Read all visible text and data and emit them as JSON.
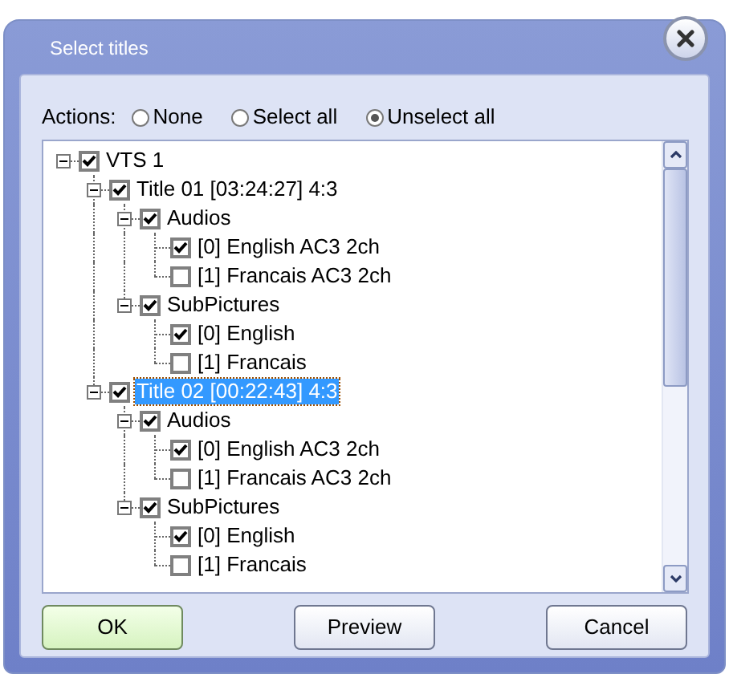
{
  "window": {
    "title": "Select titles"
  },
  "actions": {
    "label": "Actions:",
    "options": [
      {
        "label": "None",
        "selected": false
      },
      {
        "label": "Select all",
        "selected": false
      },
      {
        "label": "Unselect all",
        "selected": true
      }
    ]
  },
  "tree": [
    {
      "label": "VTS 1",
      "checked": true,
      "expanded": true,
      "selected": false,
      "children": [
        {
          "label": "Title 01 [03:24:27] 4:3",
          "checked": true,
          "expanded": true,
          "selected": false,
          "children": [
            {
              "label": "Audios",
              "checked": true,
              "expanded": true,
              "selected": false,
              "children": [
                {
                  "label": "[0] English AC3 2ch",
                  "checked": true,
                  "selected": false
                },
                {
                  "label": "[1] Francais AC3 2ch",
                  "checked": false,
                  "selected": false
                }
              ]
            },
            {
              "label": "SubPictures",
              "checked": true,
              "expanded": true,
              "selected": false,
              "children": [
                {
                  "label": "[0] English",
                  "checked": true,
                  "selected": false
                },
                {
                  "label": "[1] Francais",
                  "checked": false,
                  "selected": false
                }
              ]
            }
          ]
        },
        {
          "label": "Title 02 [00:22:43] 4:3",
          "checked": true,
          "expanded": true,
          "selected": true,
          "children": [
            {
              "label": "Audios",
              "checked": true,
              "expanded": true,
              "selected": false,
              "children": [
                {
                  "label": "[0] English AC3 2ch",
                  "checked": true,
                  "selected": false
                },
                {
                  "label": "[1] Francais AC3 2ch",
                  "checked": false,
                  "selected": false
                }
              ]
            },
            {
              "label": "SubPictures",
              "checked": true,
              "expanded": true,
              "selected": false,
              "children": [
                {
                  "label": "[0] English",
                  "checked": true,
                  "selected": false
                },
                {
                  "label": "[1] Francais",
                  "checked": false,
                  "selected": false
                }
              ]
            }
          ]
        }
      ]
    }
  ],
  "buttons": [
    {
      "label": "OK",
      "kind": "default"
    },
    {
      "label": "Preview",
      "kind": "normal"
    },
    {
      "label": "Cancel",
      "kind": "normal"
    }
  ]
}
